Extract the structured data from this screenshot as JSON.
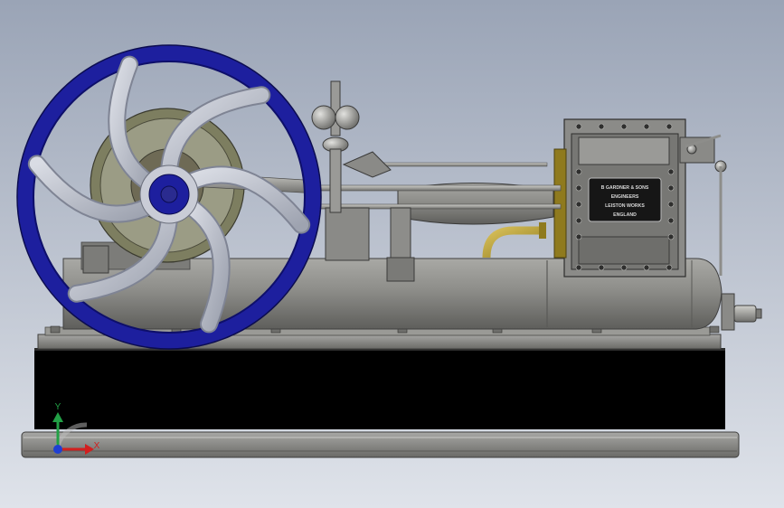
{
  "viewport": {
    "background_top": "#9aa4b6",
    "background_bottom": "#dfe3ea"
  },
  "model": {
    "nameplate": [
      "B GARDNER & SONS",
      "ENGINEERS",
      "LEISTON WORKS",
      "ENGLAND"
    ],
    "flywheel_color": "#1d1f9e",
    "brass_color": "#b39a2e",
    "base_color": "#000000",
    "body_color": "#8f8f8b"
  },
  "triad": {
    "x_label": "X",
    "y_label": "Y",
    "x_color": "#d21f1f",
    "y_color": "#22a046",
    "z_color": "#1f3fd2"
  }
}
